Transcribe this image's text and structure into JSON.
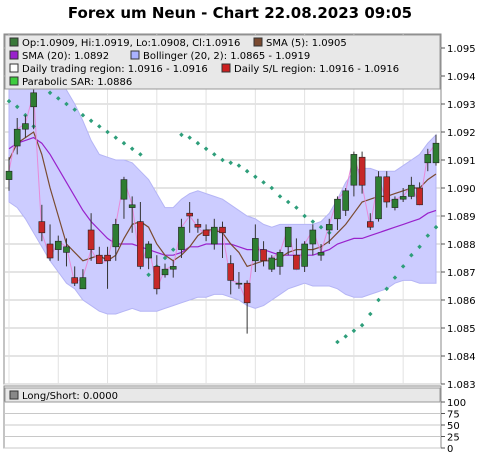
{
  "title": "Forex um Neun - Chart 22.08.2023 09:05",
  "legend": [
    {
      "label": "Op:1.0909, Hi:1.0919, Lo:1.0908, Cl:1.0916",
      "swatch": "#3a7a3a",
      "kind": "box"
    },
    {
      "label": "SMA (5): 1.0905",
      "swatch": "#7a4a30",
      "kind": "box"
    },
    {
      "label": "SMA (20): 1.0892",
      "swatch": "#9922cc",
      "kind": "box"
    },
    {
      "label": "Bollinger (20, 2): 1.0865 - 1.0919",
      "swatch": "#aab2ff",
      "kind": "box"
    },
    {
      "label": "Daily trading region: 1.0916 - 1.0916",
      "swatch": "#ffffff",
      "kind": "outline"
    },
    {
      "label": "Daily S/L region: 1.0916 - 1.0916",
      "swatch": "#cc1f1f",
      "kind": "box"
    },
    {
      "label": "Parabolic SAR: 1.0886",
      "swatch": "#3ecc3e",
      "kind": "box"
    }
  ],
  "lower_legend": {
    "label": "Long/Short: 0.0000",
    "swatch": "#888888"
  },
  "colors": {
    "up": "#2e7d32",
    "down": "#c62828",
    "band_fill": "#ccccff",
    "band_line": "#b5b5f5",
    "sma5": "#7a4a30",
    "sma20": "#9922cc",
    "sar": "#2e9e7a",
    "grid": "#c8c8c8",
    "wick": "#333333"
  },
  "chart_data": [
    {
      "type": "candlestick",
      "title": "Forex um Neun - Chart 22.08.2023 09:05",
      "ylim": [
        1.083,
        1.0955
      ],
      "y_ticks": [
        "1.083",
        "1.084",
        "1.085",
        "1.086",
        "1.087",
        "1.088",
        "1.089",
        "1.090",
        "1.091",
        "1.092",
        "1.093",
        "1.094",
        "1.095"
      ],
      "grid": true,
      "candles": [
        {
          "o": 1.0903,
          "h": 1.0911,
          "l": 1.0899,
          "c": 1.0906
        },
        {
          "o": 1.0915,
          "h": 1.0925,
          "l": 1.0912,
          "c": 1.0921
        },
        {
          "o": 1.0921,
          "h": 1.0926,
          "l": 1.0918,
          "c": 1.0923
        },
        {
          "o": 1.0929,
          "h": 1.0936,
          "l": 1.0921,
          "c": 1.0934
        },
        {
          "o": 1.0888,
          "h": 1.0894,
          "l": 1.0881,
          "c": 1.0884
        },
        {
          "o": 1.088,
          "h": 1.0887,
          "l": 1.0874,
          "c": 1.0875
        },
        {
          "o": 1.0878,
          "h": 1.0883,
          "l": 1.0874,
          "c": 1.0881
        },
        {
          "o": 1.0877,
          "h": 1.0882,
          "l": 1.0872,
          "c": 1.0879
        },
        {
          "o": 1.0868,
          "h": 1.0872,
          "l": 1.0865,
          "c": 1.0866
        },
        {
          "o": 1.0864,
          "h": 1.0871,
          "l": 1.0864,
          "c": 1.0868
        },
        {
          "o": 1.0885,
          "h": 1.0891,
          "l": 1.0874,
          "c": 1.0878
        },
        {
          "o": 1.0876,
          "h": 1.0879,
          "l": 1.0873,
          "c": 1.0873
        },
        {
          "o": 1.0876,
          "h": 1.0879,
          "l": 1.0864,
          "c": 1.0874
        },
        {
          "o": 1.0879,
          "h": 1.0889,
          "l": 1.0874,
          "c": 1.0887
        },
        {
          "o": 1.0896,
          "h": 1.0904,
          "l": 1.0889,
          "c": 1.0903
        },
        {
          "o": 1.0893,
          "h": 1.0897,
          "l": 1.0884,
          "c": 1.0894
        },
        {
          "o": 1.0888,
          "h": 1.0895,
          "l": 1.0871,
          "c": 1.0872
        },
        {
          "o": 1.0875,
          "h": 1.0881,
          "l": 1.0871,
          "c": 1.088
        },
        {
          "o": 1.0872,
          "h": 1.0876,
          "l": 1.0862,
          "c": 1.0864
        },
        {
          "o": 1.0869,
          "h": 1.0873,
          "l": 1.0868,
          "c": 1.0871
        },
        {
          "o": 1.0871,
          "h": 1.0874,
          "l": 1.0868,
          "c": 1.0872
        },
        {
          "o": 1.0878,
          "h": 1.0889,
          "l": 1.0875,
          "c": 1.0886
        },
        {
          "o": 1.0891,
          "h": 1.0895,
          "l": 1.0884,
          "c": 1.089
        },
        {
          "o": 1.0887,
          "h": 1.0889,
          "l": 1.0884,
          "c": 1.0886
        },
        {
          "o": 1.0885,
          "h": 1.0887,
          "l": 1.0881,
          "c": 1.0883
        },
        {
          "o": 1.088,
          "h": 1.0889,
          "l": 1.0878,
          "c": 1.0886
        },
        {
          "o": 1.0886,
          "h": 1.0888,
          "l": 1.0875,
          "c": 1.0884
        },
        {
          "o": 1.0873,
          "h": 1.0876,
          "l": 1.0862,
          "c": 1.0867
        },
        {
          "o": 1.0866,
          "h": 1.087,
          "l": 1.0864,
          "c": 1.0866
        },
        {
          "o": 1.0866,
          "h": 1.0867,
          "l": 1.0848,
          "c": 1.0859
        },
        {
          "o": 1.0874,
          "h": 1.0887,
          "l": 1.087,
          "c": 1.0882
        },
        {
          "o": 1.0878,
          "h": 1.0881,
          "l": 1.0872,
          "c": 1.0874
        },
        {
          "o": 1.0871,
          "h": 1.0876,
          "l": 1.087,
          "c": 1.0875
        },
        {
          "o": 1.0872,
          "h": 1.0878,
          "l": 1.0869,
          "c": 1.0877
        },
        {
          "o": 1.0879,
          "h": 1.0886,
          "l": 1.0876,
          "c": 1.0886
        },
        {
          "o": 1.0876,
          "h": 1.0882,
          "l": 1.0871,
          "c": 1.0871
        },
        {
          "o": 1.0872,
          "h": 1.0881,
          "l": 1.087,
          "c": 1.088
        },
        {
          "o": 1.088,
          "h": 1.0887,
          "l": 1.0876,
          "c": 1.0885
        },
        {
          "o": 1.0876,
          "h": 1.088,
          "l": 1.0874,
          "c": 1.0877
        },
        {
          "o": 1.0885,
          "h": 1.0889,
          "l": 1.088,
          "c": 1.0887
        },
        {
          "o": 1.0889,
          "h": 1.0897,
          "l": 1.0885,
          "c": 1.0896
        },
        {
          "o": 1.0892,
          "h": 1.09,
          "l": 1.089,
          "c": 1.0899
        },
        {
          "o": 1.0901,
          "h": 1.0913,
          "l": 1.0897,
          "c": 1.0912
        },
        {
          "o": 1.0911,
          "h": 1.0913,
          "l": 1.0898,
          "c": 1.0901
        },
        {
          "o": 1.0888,
          "h": 1.0891,
          "l": 1.0885,
          "c": 1.0886
        },
        {
          "o": 1.0889,
          "h": 1.0906,
          "l": 1.0888,
          "c": 1.0904
        },
        {
          "o": 1.0904,
          "h": 1.0906,
          "l": 1.0893,
          "c": 1.0895
        },
        {
          "o": 1.0893,
          "h": 1.0897,
          "l": 1.0892,
          "c": 1.0896
        },
        {
          "o": 1.0896,
          "h": 1.09,
          "l": 1.0895,
          "c": 1.0897
        },
        {
          "o": 1.0897,
          "h": 1.0904,
          "l": 1.0896,
          "c": 1.0901
        },
        {
          "o": 1.09,
          "h": 1.0902,
          "l": 1.0894,
          "c": 1.0894
        },
        {
          "o": 1.0909,
          "h": 1.0914,
          "l": 1.0906,
          "c": 1.0912
        },
        {
          "o": 1.0909,
          "h": 1.0919,
          "l": 1.0908,
          "c": 1.0916
        }
      ],
      "sma5": [
        1.091,
        1.0916,
        1.0918,
        1.092,
        1.0912,
        1.09,
        1.089,
        1.088,
        1.0877,
        1.0874,
        1.0875,
        1.0876,
        1.0874,
        1.0876,
        1.0882,
        1.0887,
        1.0888,
        1.0886,
        1.088,
        1.0876,
        1.0874,
        1.0876,
        1.0879,
        1.0883,
        1.0885,
        1.0885,
        1.0884,
        1.088,
        1.0877,
        1.0872,
        1.0873,
        1.0874,
        1.0874,
        1.0875,
        1.0877,
        1.0878,
        1.0878,
        1.0878,
        1.0879,
        1.0881,
        1.0884,
        1.0887,
        1.0891,
        1.0895,
        1.0896,
        1.0897,
        1.0897,
        1.0898,
        1.0899,
        1.09,
        1.09,
        1.0903,
        1.0905
      ],
      "sma20": [
        1.0914,
        1.0916,
        1.0917,
        1.0918,
        1.0916,
        1.0912,
        1.0907,
        1.0902,
        1.0897,
        1.0892,
        1.0888,
        1.0885,
        1.0882,
        1.088,
        1.088,
        1.088,
        1.0879,
        1.0878,
        1.0877,
        1.0876,
        1.0876,
        1.0877,
        1.0879,
        1.0879,
        1.088,
        1.088,
        1.088,
        1.088,
        1.0879,
        1.0878,
        1.0878,
        1.0878,
        1.0877,
        1.0876,
        1.0876,
        1.0876,
        1.0876,
        1.0876,
        1.0877,
        1.0878,
        1.088,
        1.0881,
        1.0882,
        1.0882,
        1.0883,
        1.0884,
        1.0885,
        1.0886,
        1.0887,
        1.0888,
        1.0889,
        1.0891,
        1.0892
      ],
      "bollinger_upper": [
        1.0942,
        1.0944,
        1.0945,
        1.0945,
        1.0944,
        1.0942,
        1.094,
        1.0935,
        1.093,
        1.0924,
        1.0917,
        1.0912,
        1.0911,
        1.091,
        1.091,
        1.0909,
        1.0906,
        1.0903,
        1.0898,
        1.0893,
        1.0893,
        1.0896,
        1.0898,
        1.0899,
        1.0898,
        1.0897,
        1.0896,
        1.0894,
        1.0892,
        1.089,
        1.0889,
        1.0887,
        1.0886,
        1.0887,
        1.0887,
        1.0887,
        1.0887,
        1.0887,
        1.0888,
        1.0891,
        1.0896,
        1.0902,
        1.0906,
        1.0907,
        1.0907,
        1.0906,
        1.0906,
        1.0906,
        1.0908,
        1.091,
        1.0912,
        1.0916,
        1.0919
      ],
      "bollinger_lower": [
        1.0895,
        1.0893,
        1.0889,
        1.0884,
        1.0879,
        1.0874,
        1.087,
        1.0866,
        1.0864,
        1.086,
        1.0858,
        1.0856,
        1.0855,
        1.0855,
        1.0856,
        1.0857,
        1.0856,
        1.0856,
        1.0856,
        1.0857,
        1.0858,
        1.0859,
        1.086,
        1.0861,
        1.0861,
        1.0862,
        1.0862,
        1.0861,
        1.086,
        1.0858,
        1.0857,
        1.0858,
        1.086,
        1.0862,
        1.0864,
        1.0865,
        1.0866,
        1.0865,
        1.0865,
        1.0865,
        1.0864,
        1.0862,
        1.0861,
        1.0861,
        1.0862,
        1.0863,
        1.0864,
        1.0866,
        1.0867,
        1.0867,
        1.0866,
        1.0866,
        1.0866
      ],
      "parabolic_sar": [
        1.0931,
        1.0929,
        1.0926,
        1.0922,
        1.0936,
        1.0934,
        1.0932,
        1.093,
        1.0928,
        1.0926,
        1.0924,
        1.0922,
        1.092,
        1.0918,
        1.0916,
        1.0914,
        1.0912,
        1.0869,
        1.0872,
        1.0875,
        1.0878,
        1.0919,
        1.0918,
        1.0916,
        1.0914,
        1.0912,
        1.091,
        1.0909,
        1.0908,
        1.0906,
        1.0904,
        1.0902,
        1.09,
        1.0897,
        1.0895,
        1.0893,
        1.089,
        1.0888,
        1.0886,
        1.0884,
        1.0845,
        1.0847,
        1.0849,
        1.0851,
        1.0855,
        1.086,
        1.0864,
        1.0868,
        1.0872,
        1.0876,
        1.0879,
        1.0883,
        1.0886
      ]
    },
    {
      "type": "line",
      "title": "Long/Short",
      "ylim": [
        0,
        100
      ],
      "y_ticks": [
        "0",
        "25",
        "50",
        "75",
        "100"
      ],
      "values": [
        0
      ]
    }
  ]
}
